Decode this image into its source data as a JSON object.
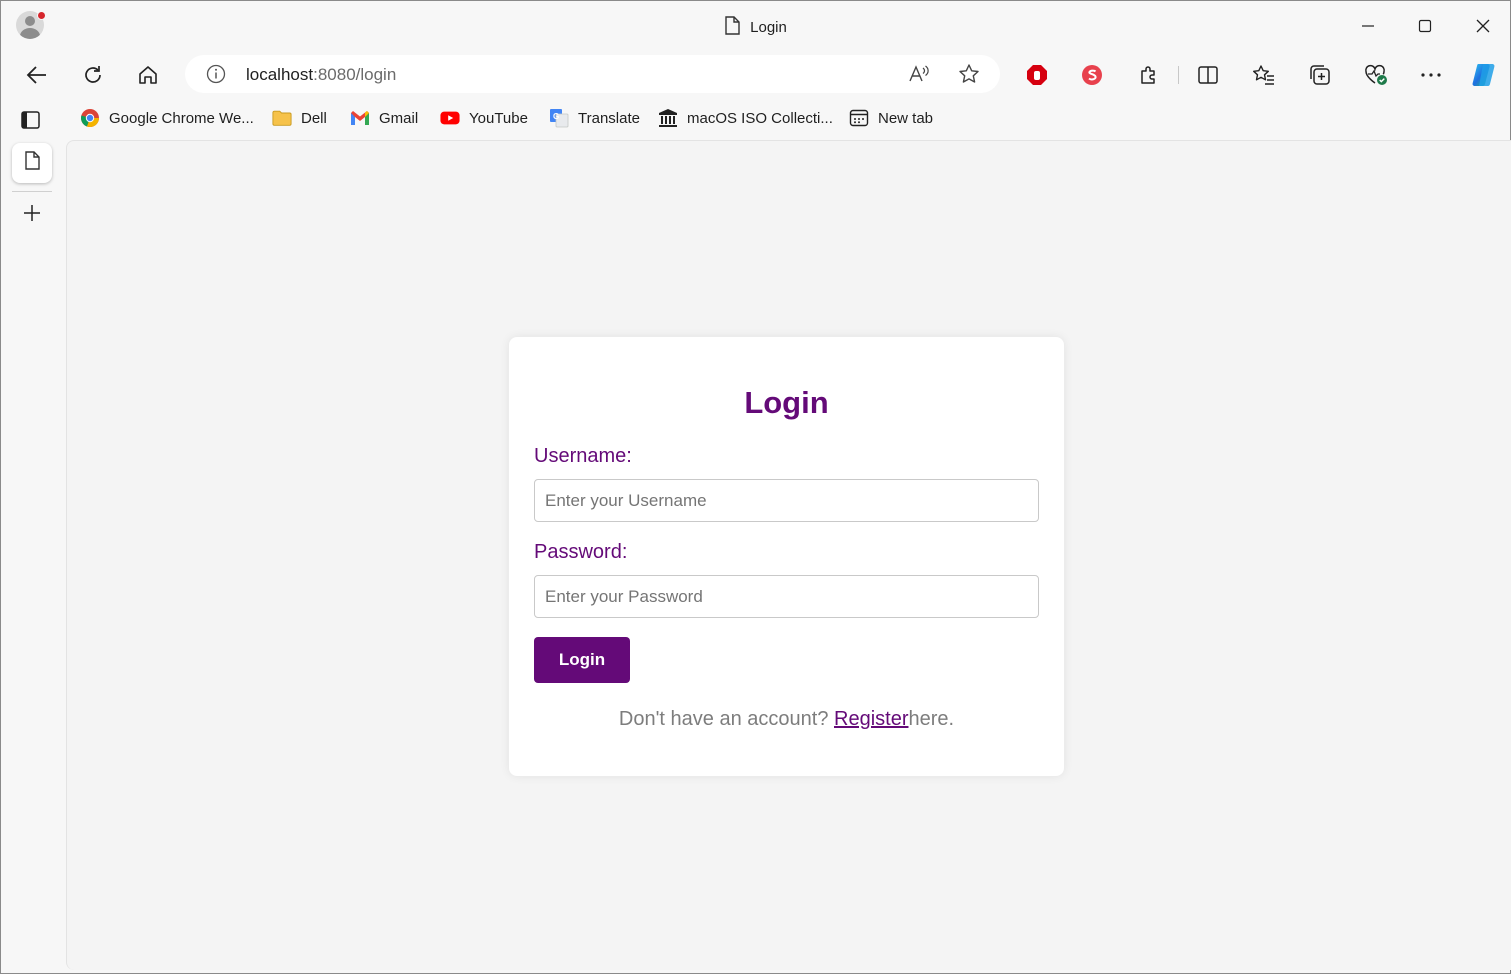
{
  "window": {
    "tab_title": "Login"
  },
  "toolbar": {
    "url_host": "localhost",
    "url_rest": ":8080/login"
  },
  "bookmarks": [
    {
      "label": "Google Chrome We...",
      "icon": "chrome-icon"
    },
    {
      "label": "Dell",
      "icon": "folder-icon"
    },
    {
      "label": "Gmail",
      "icon": "gmail-icon"
    },
    {
      "label": "YouTube",
      "icon": "youtube-icon"
    },
    {
      "label": "Translate",
      "icon": "translate-icon"
    },
    {
      "label": "macOS ISO Collecti...",
      "icon": "archive-icon"
    },
    {
      "label": "New tab",
      "icon": "new-tab-icon"
    }
  ],
  "form": {
    "title": "Login",
    "username_label": "Username:",
    "username_placeholder": "Enter your Username",
    "password_label": "Password:",
    "password_placeholder": "Enter your Password",
    "submit_label": "Login",
    "footer_prefix": "Don't have an account? ",
    "footer_link": "Register",
    "footer_suffix": "here."
  },
  "colors": {
    "accent": "#640a78",
    "page_bg": "#f4f4f4",
    "card_bg": "#ffffff"
  }
}
